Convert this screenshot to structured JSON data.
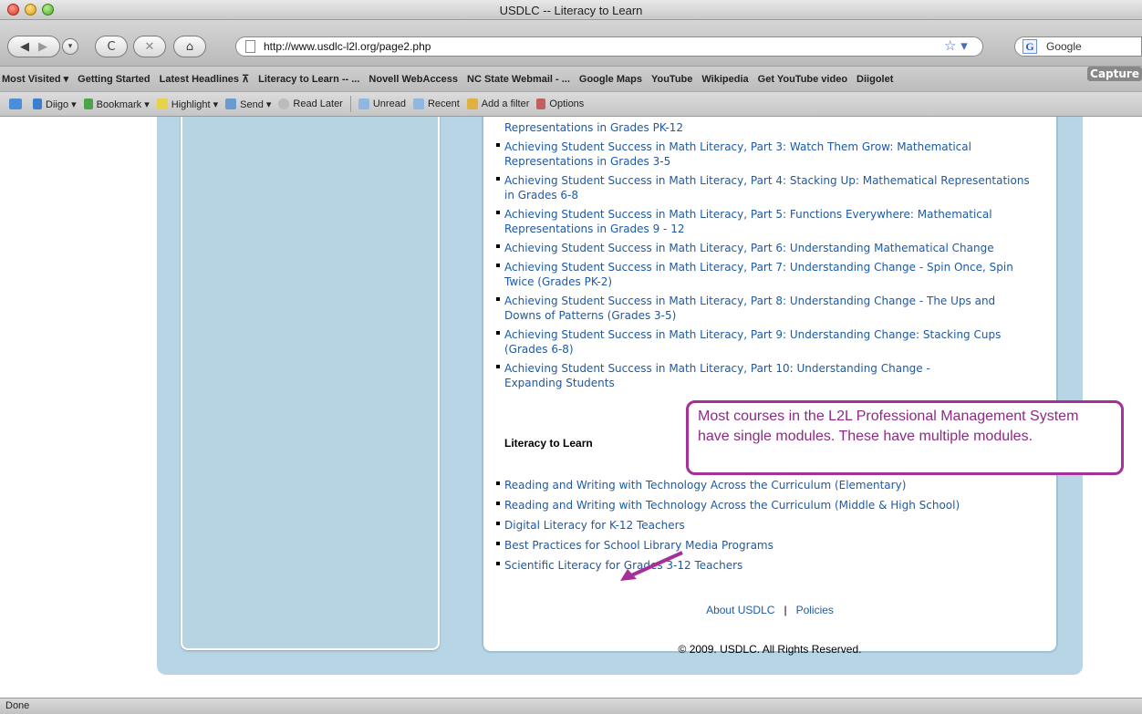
{
  "window": {
    "title": "USDLC -- Literacy to Learn"
  },
  "nav": {
    "url": "http://www.usdlc-l2l.org/page2.php",
    "search_placeholder": "Google"
  },
  "bookmarks": {
    "items": [
      "Most Visited ▾",
      "Getting Started",
      "Latest Headlines ⊼",
      "Literacy to Learn -- ...",
      "Novell WebAccess",
      "NC State Webmail - ...",
      "Google Maps",
      "YouTube",
      "Wikipedia",
      "Get YouTube video",
      "Diigolet"
    ],
    "capture_label": "Capture"
  },
  "diigo": {
    "items": [
      "Diigo ▾",
      "Bookmark ▾",
      "Highlight ▾",
      "Send ▾",
      "Read Later",
      "Unread",
      "Recent",
      "Add a filter",
      "Options"
    ]
  },
  "content": {
    "top_links": [
      "Representations in Grades PK-12",
      "Achieving Student Success in Math Literacy, Part 3: Watch Them Grow: Mathematical Representations in Grades 3-5",
      "Achieving Student Success in Math Literacy, Part 4: Stacking Up: Mathematical Representations in Grades 6-8",
      "Achieving Student Success in Math Literacy, Part 5: Functions Everywhere: Mathematical Representations in Grades 9 - 12",
      "Achieving Student Success in Math Literacy, Part 6: Understanding Mathematical Change",
      "Achieving Student Success in Math Literacy, Part 7: Understanding Change - Spin Once, Spin Twice (Grades PK-2)",
      "Achieving Student Success in Math Literacy, Part 8: Understanding Change - The Ups and Downs of Patterns (Grades 3-5)",
      "Achieving Student Success in Math Literacy, Part 9: Understanding Change: Stacking Cups (Grades 6-8)",
      "Achieving Student Success in Math Literacy, Part 10: Understanding Change - Expanding Students"
    ],
    "section_heading": "Literacy to Learn",
    "section_links": [
      "Reading and Writing with Technology Across the Curriculum (Elementary)",
      "Reading and Writing with Technology Across the Curriculum (Middle & High School)",
      "Digital Literacy for K-12 Teachers",
      "Best Practices for School Library Media Programs",
      "Scientific Literacy for Grades 3-12 Teachers"
    ],
    "footer": {
      "about": "About USDLC",
      "separator": "|",
      "policies": "Policies",
      "copyright": "© 2009. USDLC. All Rights Reserved."
    },
    "callout": "Most courses in the L2L Professional Management System have single modules.  These have multiple modules."
  },
  "status": {
    "text": "Done"
  },
  "colors": {
    "link": "#1d5aa6",
    "panel": "#b7d5e4",
    "callout": "#a5309a"
  }
}
